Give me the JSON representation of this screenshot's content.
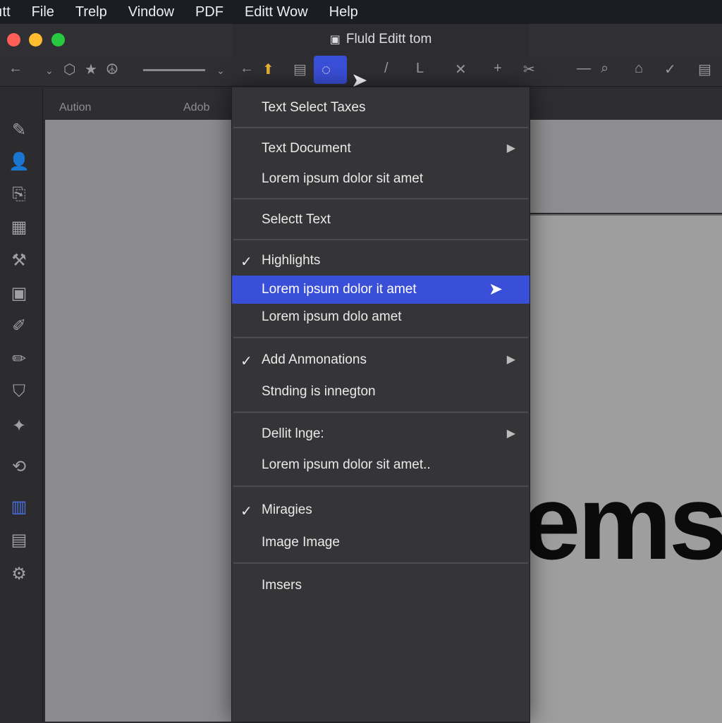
{
  "menubar": {
    "items": [
      "ıtt",
      "File",
      "Trelp",
      "Vindow",
      "PDF",
      "Editt Wow",
      "Help"
    ]
  },
  "window": {
    "traffic": [
      "#ff5f57",
      "#febc2e",
      "#28c840"
    ],
    "dropdown_title": "Fluld Editt tom"
  },
  "toolbar": {
    "selected_color": "#3a4fd8"
  },
  "ruler": {
    "left_label": "Aution",
    "right_label": "Adob"
  },
  "menu": {
    "items": [
      {
        "label": "Text Select Taxes"
      },
      {
        "label": "Text Document",
        "submenu": true
      },
      {
        "label": "Lorem ipsum dolor sit amet"
      },
      {
        "label": "Selectt Text"
      },
      {
        "label": "Highlights",
        "checked": true
      },
      {
        "label": "Lorem ipsum dolor it amet",
        "highlighted": true
      },
      {
        "label": "Lorem ipsum dolo amet"
      },
      {
        "label": "Add Anmonations",
        "checked": true,
        "submenu": true
      },
      {
        "label": "Stnding is innegton"
      },
      {
        "label": "Dellit lnge:",
        "submenu": true
      },
      {
        "label": "Lorem ipsum dolor sit amet.."
      },
      {
        "label": "Miragies",
        "checked": true
      },
      {
        "label": "Image Image"
      },
      {
        "label": "Imsers"
      }
    ]
  },
  "document": {
    "big_text": "ems"
  }
}
